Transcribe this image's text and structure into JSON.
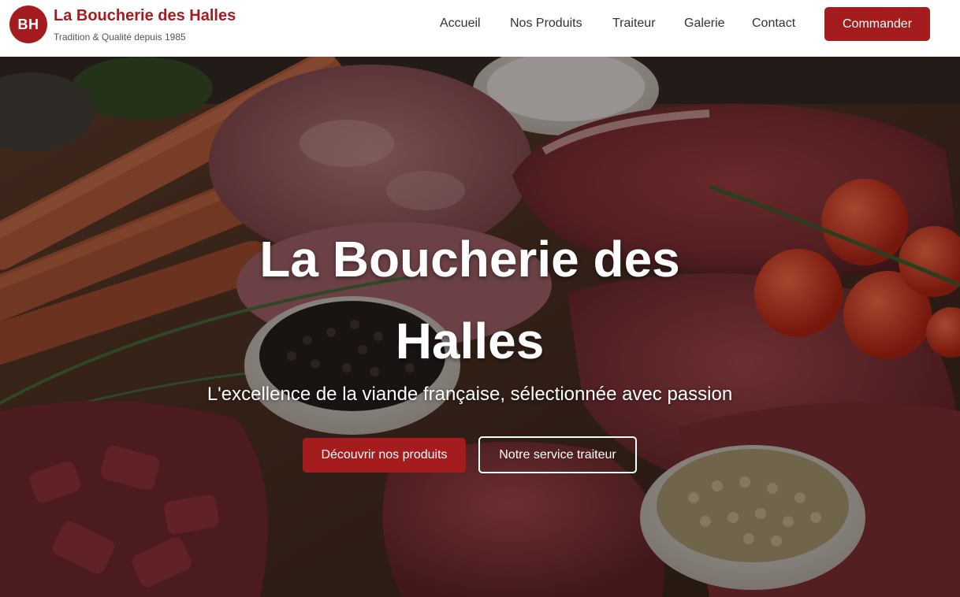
{
  "header": {
    "logo_initials": "BH",
    "brand_name": "La Boucherie des Halles",
    "tagline": "Tradition & Qualité depuis 1985",
    "nav": [
      {
        "label": "Accueil"
      },
      {
        "label": "Nos Produits"
      },
      {
        "label": "Traiteur"
      },
      {
        "label": "Galerie"
      },
      {
        "label": "Contact"
      }
    ],
    "cta_label": "Commander"
  },
  "hero": {
    "title_line1": "La Boucherie des",
    "title_line2": "Halles",
    "subtitle": "L'excellence de la viande française, sélectionnée avec passion",
    "primary_button": "Découvrir nos produits",
    "secondary_button": "Notre service traiteur"
  },
  "colors": {
    "accent": "#a51c1e",
    "header_bg": "#ffffff",
    "nav_text": "#333333",
    "tagline_text": "#555555",
    "hero_text": "#ffffff"
  }
}
